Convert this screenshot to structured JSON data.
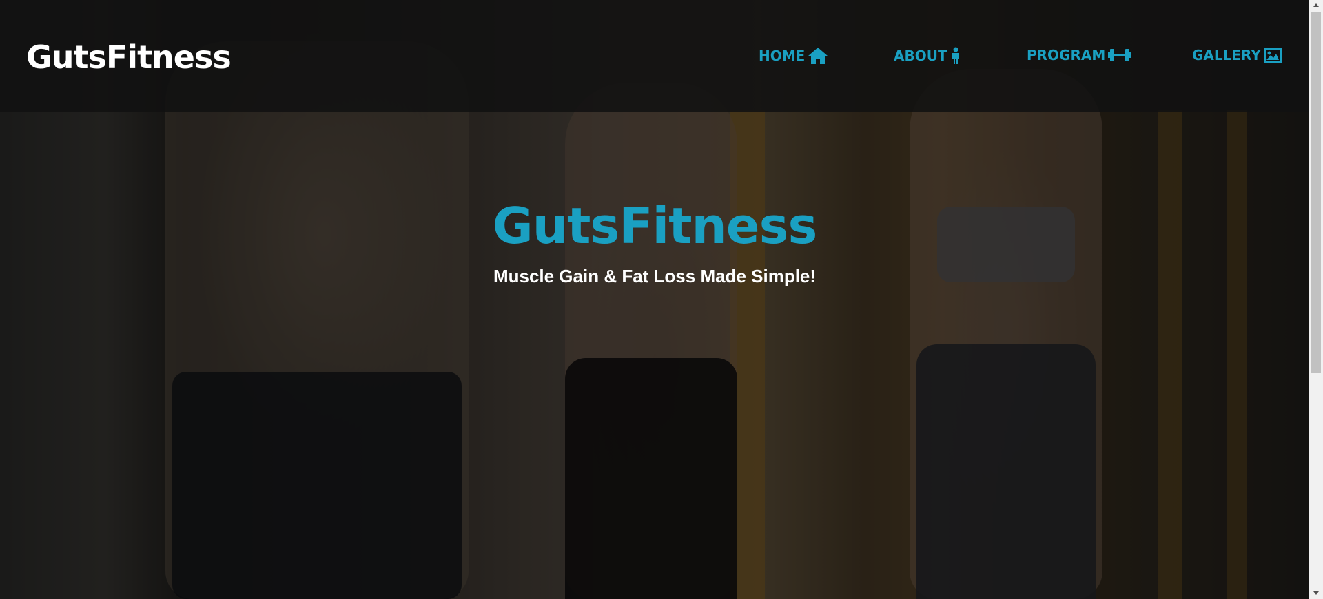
{
  "header": {
    "brand": "GutsFitness",
    "nav": [
      {
        "label": "HOME",
        "icon": "home-icon"
      },
      {
        "label": "ABOUT",
        "icon": "person-icon"
      },
      {
        "label": "PROGRAM",
        "icon": "dumbbell-icon"
      },
      {
        "label": "GALLERY",
        "icon": "image-icon"
      }
    ]
  },
  "hero": {
    "title": "GutsFitness",
    "subtitle": "Muscle Gain & Fat Loss Made Simple!"
  },
  "colors": {
    "accent": "#1aa0c2",
    "header_bg": "#111111",
    "text": "#ffffff"
  }
}
